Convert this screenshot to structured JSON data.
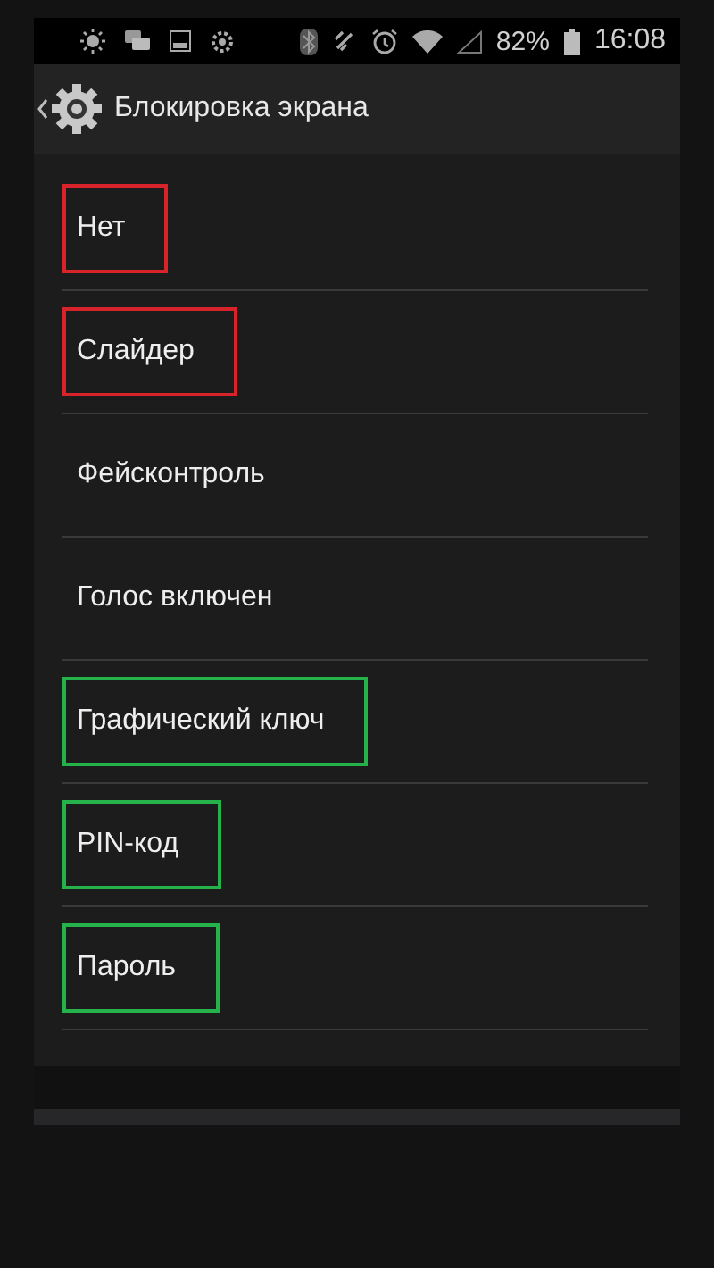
{
  "status_bar": {
    "battery": "82%",
    "time": "16:08"
  },
  "header": {
    "title": "Блокировка экрана"
  },
  "options": [
    {
      "label": "Нет",
      "color": "#d8232a"
    },
    {
      "label": "Слайдер",
      "color": "#d8232a"
    },
    {
      "label": "Фейсконтроль"
    },
    {
      "label": "Голос включен"
    },
    {
      "label": "Графический ключ",
      "color": "#25b24a"
    },
    {
      "label": "PIN-код",
      "color": "#25b24a"
    },
    {
      "label": "Пароль",
      "color": "#25b24a"
    }
  ]
}
